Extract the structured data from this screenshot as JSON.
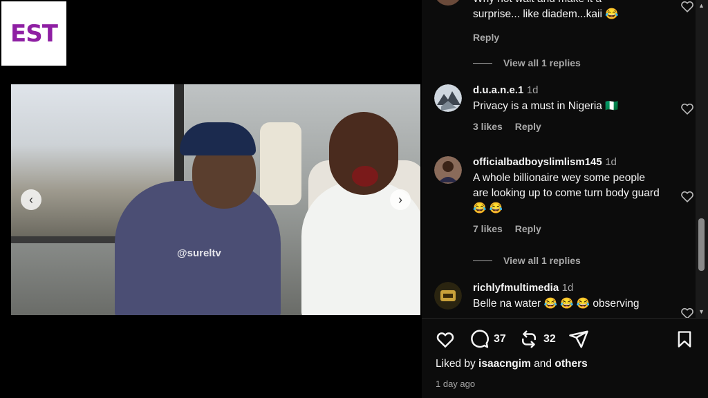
{
  "logo": {
    "text": "EST"
  },
  "video": {
    "watermark": "@sureltv"
  },
  "comments": [
    {
      "text_partial_top": "Why not wait and make it a",
      "text": "surprise... like diadem...kaii 😂",
      "reply_label": "Reply"
    },
    {
      "view_replies": "View all 1 replies"
    },
    {
      "username": "d.u.a.n.e.1",
      "time": "1d",
      "text": "Privacy is a must in Nigeria 🇳🇬",
      "likes": "3 likes",
      "reply_label": "Reply"
    },
    {
      "username": "officialbadboyslimlism145",
      "time": "1d",
      "text": "A whole billionaire wey some people are looking up to come turn body guard 😂 😂",
      "likes": "7 likes",
      "reply_label": "Reply"
    },
    {
      "view_replies": "View all 1 replies"
    },
    {
      "username": "richlyfmultimedia",
      "time": "1d",
      "text": "Belle na water 😂 😂 😂 observing"
    }
  ],
  "actions": {
    "comment_count": "37",
    "repost_count": "32"
  },
  "liked_by": {
    "prefix": "Liked by",
    "user": "isaacngim",
    "joiner": "and",
    "others": "others"
  },
  "post_age": "1 day ago"
}
